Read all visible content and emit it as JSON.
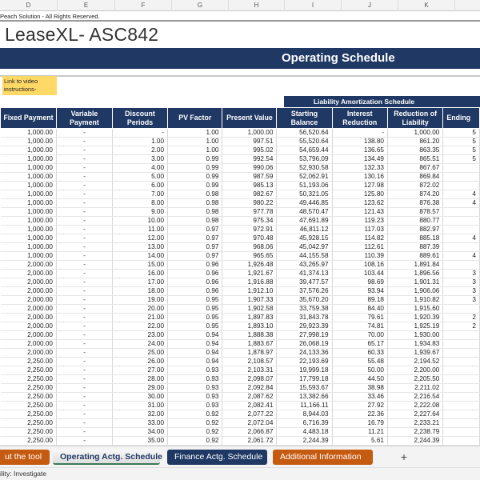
{
  "sheet": {
    "column_letters": [
      "D",
      "E",
      "F",
      "G",
      "H",
      "I",
      "J",
      "K"
    ],
    "copyright": "Peach Solution - All Rights Reserved.",
    "app_title": "LeaseXL- ASC842",
    "banner_title": "Operating Schedule",
    "video_link": "Link to video instructions-",
    "group_header": "Liability Amortization Schedule"
  },
  "table": {
    "headers": [
      "Fixed Payment",
      "Variable Payment",
      "Discount Periods",
      "PV Factor",
      "Present Value",
      "Starting Balance",
      "Interest Reduction",
      "Reduction of Liability",
      "Ending"
    ],
    "rows": [
      [
        "1,000.00",
        "-",
        "-",
        "1.00",
        "1,000.00",
        "56,520.64",
        "-",
        "1,000.00",
        "5"
      ],
      [
        "1,000.00",
        "-",
        "1.00",
        "1.00",
        "997.51",
        "55,520.64",
        "138.80",
        "861.20",
        "5"
      ],
      [
        "1,000.00",
        "-",
        "2.00",
        "1.00",
        "995.02",
        "54,659.44",
        "136.65",
        "863.35",
        "5"
      ],
      [
        "1,000.00",
        "-",
        "3.00",
        "0.99",
        "992.54",
        "53,796.09",
        "134.49",
        "865.51",
        "5"
      ],
      [
        "1,000.00",
        "-",
        "4.00",
        "0.99",
        "990.06",
        "52,930.58",
        "132.33",
        "867.67",
        ""
      ],
      [
        "1,000.00",
        "-",
        "5.00",
        "0.99",
        "987.59",
        "52,062.91",
        "130.16",
        "869.84",
        ""
      ],
      [
        "1,000.00",
        "-",
        "6.00",
        "0.99",
        "985.13",
        "51,193.06",
        "127.98",
        "872.02",
        ""
      ],
      [
        "1,000.00",
        "-",
        "7.00",
        "0.98",
        "982.67",
        "50,321.05",
        "125.80",
        "874.20",
        "4"
      ],
      [
        "1,000.00",
        "-",
        "8.00",
        "0.98",
        "980.22",
        "49,446.85",
        "123.62",
        "876.38",
        "4"
      ],
      [
        "1,000.00",
        "-",
        "9.00",
        "0.98",
        "977.78",
        "48,570.47",
        "121.43",
        "878.57",
        ""
      ],
      [
        "1,000.00",
        "-",
        "10.00",
        "0.98",
        "975.34",
        "47,691.89",
        "119.23",
        "880.77",
        ""
      ],
      [
        "1,000.00",
        "-",
        "11.00",
        "0.97",
        "972.91",
        "46,811.12",
        "117.03",
        "882.97",
        ""
      ],
      [
        "1,000.00",
        "-",
        "12.00",
        "0.97",
        "970.48",
        "45,928.15",
        "114.82",
        "885.18",
        "4"
      ],
      [
        "1,000.00",
        "-",
        "13.00",
        "0.97",
        "968.06",
        "45,042.97",
        "112.61",
        "887.39",
        ""
      ],
      [
        "1,000.00",
        "-",
        "14.00",
        "0.97",
        "965.65",
        "44,155.58",
        "110.39",
        "889.61",
        "4"
      ],
      [
        "2,000.00",
        "-",
        "15.00",
        "0.96",
        "1,926.48",
        "43,265.97",
        "108.16",
        "1,891.84",
        ""
      ],
      [
        "2,000.00",
        "-",
        "16.00",
        "0.96",
        "1,921.67",
        "41,374.13",
        "103.44",
        "1,896.56",
        "3"
      ],
      [
        "2,000.00",
        "-",
        "17.00",
        "0.96",
        "1,916.88",
        "39,477.57",
        "98.69",
        "1,901.31",
        "3"
      ],
      [
        "2,000.00",
        "-",
        "18.00",
        "0.96",
        "1,912.10",
        "37,576.26",
        "93.94",
        "1,906.06",
        "3"
      ],
      [
        "2,000.00",
        "-",
        "19.00",
        "0.95",
        "1,907.33",
        "35,670.20",
        "89.18",
        "1,910.82",
        "3"
      ],
      [
        "2,000.00",
        "-",
        "20.00",
        "0.95",
        "1,902.58",
        "33,759.38",
        "84.40",
        "1,915.60",
        ""
      ],
      [
        "2,000.00",
        "-",
        "21.00",
        "0.95",
        "1,897.83",
        "31,843.78",
        "79.61",
        "1,920.39",
        "2"
      ],
      [
        "2,000.00",
        "-",
        "22.00",
        "0.95",
        "1,893.10",
        "29,923.39",
        "74.81",
        "1,925.19",
        "2"
      ],
      [
        "2,000.00",
        "-",
        "23.00",
        "0.94",
        "1,888.38",
        "27,998.19",
        "70.00",
        "1,930.00",
        ""
      ],
      [
        "2,000.00",
        "-",
        "24.00",
        "0.94",
        "1,883.67",
        "26,068.19",
        "65.17",
        "1,934.83",
        ""
      ],
      [
        "2,000.00",
        "-",
        "25.00",
        "0.94",
        "1,878.97",
        "24,133.36",
        "60.33",
        "1,939.67",
        ""
      ],
      [
        "2,250.00",
        "-",
        "26.00",
        "0.94",
        "2,108.57",
        "22,193.69",
        "55.48",
        "2,194.52",
        ""
      ],
      [
        "2,250.00",
        "-",
        "27.00",
        "0.93",
        "2,103.31",
        "19,999.18",
        "50.00",
        "2,200.00",
        ""
      ],
      [
        "2,250.00",
        "-",
        "28.00",
        "0.93",
        "2,098.07",
        "17,799.18",
        "44.50",
        "2,205.50",
        ""
      ],
      [
        "2,250.00",
        "-",
        "29.00",
        "0.93",
        "2,092.84",
        "15,593.67",
        "38.98",
        "2,211.02",
        ""
      ],
      [
        "2,250.00",
        "-",
        "30.00",
        "0.93",
        "2,087.62",
        "13,382.66",
        "33.46",
        "2,216.54",
        ""
      ],
      [
        "2,250.00",
        "-",
        "31.00",
        "0.93",
        "2,082.41",
        "11,166.11",
        "27.92",
        "2,222.08",
        ""
      ],
      [
        "2,250.00",
        "-",
        "32.00",
        "0.92",
        "2,077.22",
        "8,944.03",
        "22.36",
        "2,227.64",
        ""
      ],
      [
        "2,250.00",
        "-",
        "33.00",
        "0.92",
        "2,072.04",
        "6,716.39",
        "16.79",
        "2,233.21",
        ""
      ],
      [
        "2,250.00",
        "-",
        "34.00",
        "0.92",
        "2,066.87",
        "4,483.18",
        "11.21",
        "2,238.79",
        ""
      ],
      [
        "2,250.00",
        "-",
        "35.00",
        "0.92",
        "2,061.72",
        "2,244.39",
        "5.61",
        "2,244.39",
        ""
      ],
      [
        "",
        "",
        "",
        "",
        "",
        "",
        "",
        "",
        ""
      ]
    ]
  },
  "tabs": {
    "about": "ut the tool",
    "operating": "Operating Actg. Schedule",
    "finance": "Finance Actg. Schedule",
    "additional": "Additional Information",
    "add_icon": "+"
  },
  "status": {
    "accessibility": "ility: Investigate"
  },
  "colors": {
    "brand_navy": "#1f3864",
    "accent_orange": "#c55a11",
    "note_yellow": "#ffd966"
  }
}
